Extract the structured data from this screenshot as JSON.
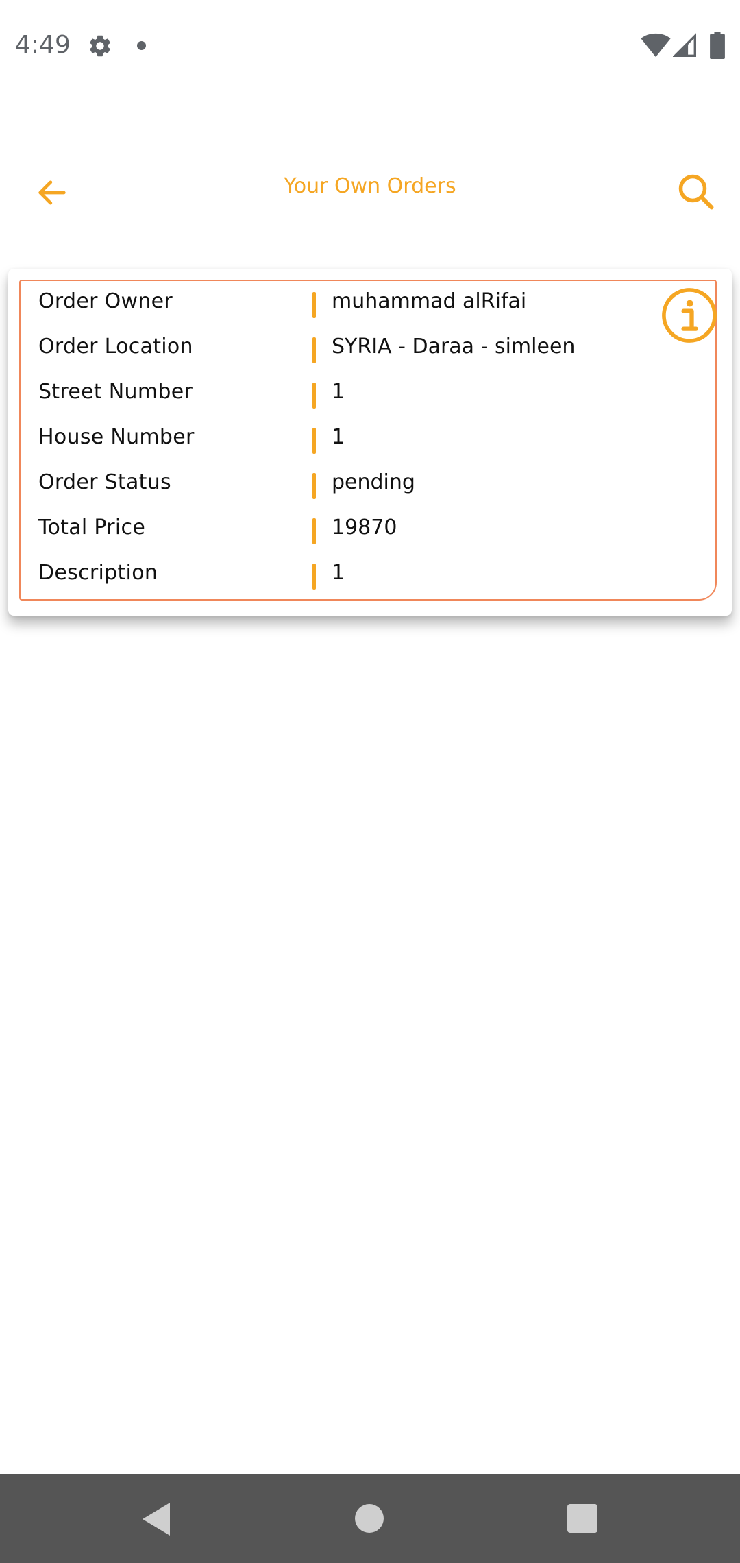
{
  "status_bar": {
    "time": "4:49",
    "icons": [
      "gear-icon",
      "notification-dot-icon",
      "wifi-icon",
      "signal-icon",
      "battery-icon"
    ]
  },
  "app_bar": {
    "title": "Your Own Orders",
    "back_icon": "arrow-left-icon",
    "search_icon": "search-icon",
    "accent_color": "#f5a623"
  },
  "order": {
    "info_icon": "info-icon",
    "border_color": "#f0875a",
    "fields": [
      {
        "label": "Order Owner",
        "value": "muhammad alRifai"
      },
      {
        "label": "Order Location",
        "value": "SYRIA - Daraa - simleen"
      },
      {
        "label": "Street Number",
        "value": "1"
      },
      {
        "label": "House Number",
        "value": "1"
      },
      {
        "label": "Order Status",
        "value": "pending"
      },
      {
        "label": "Total Price",
        "value": "19870"
      },
      {
        "label": "Description",
        "value": "1"
      }
    ]
  },
  "nav_bar": {
    "icons": [
      "nav-back-icon",
      "nav-home-icon",
      "nav-recents-icon"
    ],
    "background_color": "#555555"
  }
}
